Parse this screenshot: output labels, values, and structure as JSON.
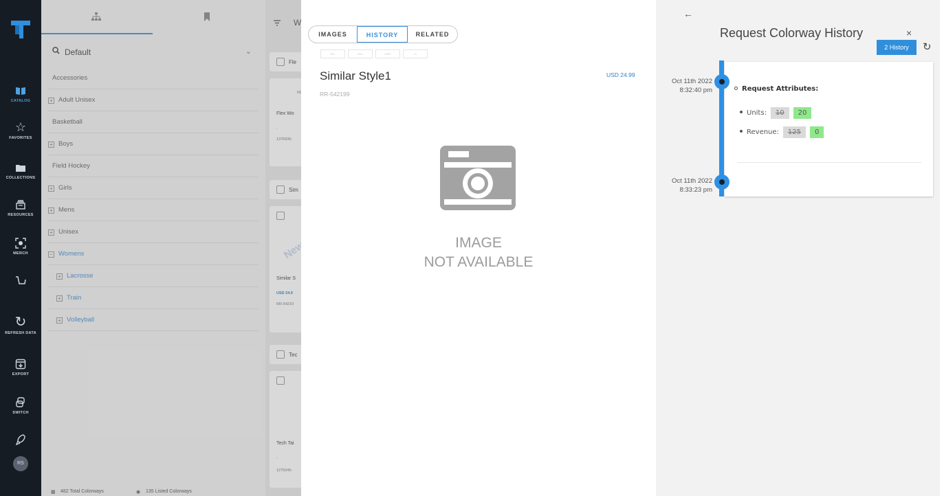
{
  "nav": {
    "items": [
      {
        "label": "CATALOG",
        "icon": "book-icon"
      },
      {
        "label": "FAVORITES",
        "icon": "star-icon"
      },
      {
        "label": "COLLECTIONS",
        "icon": "folder-icon"
      },
      {
        "label": "RESOURCES",
        "icon": "inbox-icon"
      },
      {
        "label": "MERCH",
        "icon": "scan-icon"
      },
      {
        "label": "",
        "icon": "cart-icon"
      },
      {
        "label": "REFRESH DATA",
        "icon": "refresh-icon"
      },
      {
        "label": "EXPORT",
        "icon": "export-icon"
      },
      {
        "label": "SWITCH",
        "icon": "switch-icon"
      },
      {
        "label": "",
        "icon": "rocket-icon"
      }
    ],
    "avatar": "RS",
    "active_color": "#4aa3e6"
  },
  "categories": {
    "search_value": "Default",
    "items": [
      {
        "label": "Accessories",
        "expandable": false,
        "level": 0,
        "highlight": false
      },
      {
        "label": "Adult Unisex",
        "expandable": true,
        "level": 0,
        "highlight": false
      },
      {
        "label": "Basketball",
        "expandable": false,
        "level": 0,
        "highlight": false
      },
      {
        "label": "Boys",
        "expandable": true,
        "level": 0,
        "highlight": false
      },
      {
        "label": "Field Hockey",
        "expandable": false,
        "level": 0,
        "highlight": false
      },
      {
        "label": "Girls",
        "expandable": true,
        "level": 0,
        "highlight": false
      },
      {
        "label": "Mens",
        "expandable": true,
        "level": 0,
        "highlight": false
      },
      {
        "label": "Unisex",
        "expandable": true,
        "level": 0,
        "highlight": false
      },
      {
        "label": "Womens",
        "expandable": true,
        "expanded": true,
        "level": 0,
        "highlight": true
      },
      {
        "label": "Lacrosse",
        "expandable": true,
        "level": 1,
        "highlight": true
      },
      {
        "label": "Train",
        "expandable": true,
        "level": 1,
        "highlight": true
      },
      {
        "label": "Volleyball",
        "expandable": true,
        "level": 1,
        "highlight": true
      }
    ]
  },
  "status_bar": {
    "total": "482 Total Colorways",
    "listed": "135 Listed Colorways"
  },
  "product_column": {
    "header": "W",
    "cards": [
      {
        "head": "Fle",
        "name": "Flex Wo",
        "dash": "-",
        "id": "1376936-"
      },
      {
        "head": "Sim",
        "name": "Similar S",
        "price": "USD 24.9",
        "id": "RR-54219"
      },
      {
        "head": "Tec",
        "name": "Tech Tai",
        "dash": "-",
        "id": "1275045-"
      }
    ],
    "watermark": "New"
  },
  "details": {
    "tabs": [
      "IMAGES",
      "HISTORY",
      "RELATED"
    ],
    "active_tab": "HISTORY",
    "mini_tabs": [
      "SEL",
      "SML",
      "WMP",
      "M"
    ],
    "title": "Similar Style1",
    "style_id": "RR-542199",
    "price": "USD 24.99",
    "image_placeholder_line1": "IMAGE",
    "image_placeholder_line2": "NOT AVAILABLE"
  },
  "history": {
    "title": "Request Colorway History",
    "badge": "2 History",
    "accent": "#2e90e5",
    "entries": [
      {
        "date": "Oct 11th 2022",
        "time": "8:32:40 pm"
      },
      {
        "date": "Oct 11th 2022",
        "time": "8:33:23 pm"
      }
    ],
    "card": {
      "heading": "Request Attributes:",
      "rows": [
        {
          "label": "Units:",
          "old": "10",
          "new": "20"
        },
        {
          "label": "Revenue:",
          "old": "125",
          "new": "0"
        }
      ]
    }
  }
}
